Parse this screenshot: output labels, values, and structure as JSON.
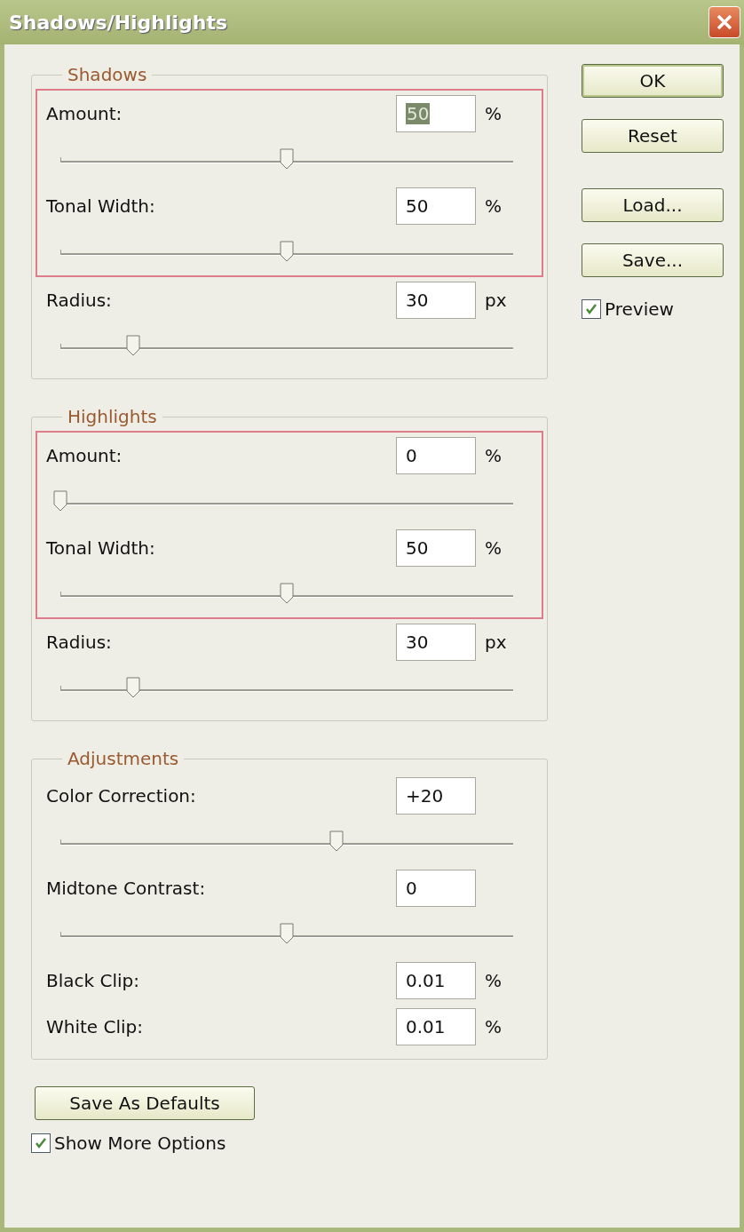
{
  "window": {
    "title": "Shadows/Highlights"
  },
  "sections": [
    {
      "legend": "Shadows",
      "boxed_rows": [
        {
          "kind": "slider",
          "label": "Amount:",
          "value": "50",
          "text_selected": true,
          "unit": "%",
          "level": 0.5
        },
        {
          "kind": "slider",
          "label": "Tonal Width:",
          "value": "50",
          "text_selected": false,
          "unit": "%",
          "level": 0.5
        }
      ],
      "rows": [
        {
          "kind": "slider",
          "label": "Radius:",
          "value": "30",
          "text_selected": false,
          "unit": "px",
          "level": 0.16
        }
      ]
    },
    {
      "legend": "Highlights",
      "boxed_rows": [
        {
          "kind": "slider",
          "label": "Amount:",
          "value": "0",
          "text_selected": false,
          "unit": "%",
          "level": 0
        },
        {
          "kind": "slider",
          "label": "Tonal Width:",
          "value": "50",
          "text_selected": false,
          "unit": "%",
          "level": 0.5
        }
      ],
      "rows": [
        {
          "kind": "slider",
          "label": "Radius:",
          "value": "30",
          "text_selected": false,
          "unit": "px",
          "level": 0.16
        }
      ]
    },
    {
      "legend": "Adjustments",
      "rows": [
        {
          "kind": "slider",
          "label": "Color Correction:",
          "value": "+20",
          "text_selected": false,
          "level": 0.61
        },
        {
          "kind": "slider",
          "label": "Midtone Contrast:",
          "value": "0",
          "text_selected": false,
          "level": 0.5
        },
        {
          "kind": "field",
          "label": "Black Clip:",
          "value": "0.01",
          "text_selected": false,
          "unit": "%"
        },
        {
          "kind": "field",
          "label": "White Clip:",
          "value": "0.01",
          "text_selected": false,
          "unit": "%"
        }
      ]
    }
  ],
  "buttons": [
    {
      "label": "OK",
      "default": true
    },
    {
      "label": "Reset",
      "default": false
    },
    {
      "label": "Load...",
      "default": false
    },
    {
      "label": "Save...",
      "default": false
    }
  ],
  "preview": {
    "label": "Preview",
    "checked": true
  },
  "save_defaults_button": "Save As Defaults",
  "more_options": {
    "label": "Show More Options",
    "checked": true
  }
}
